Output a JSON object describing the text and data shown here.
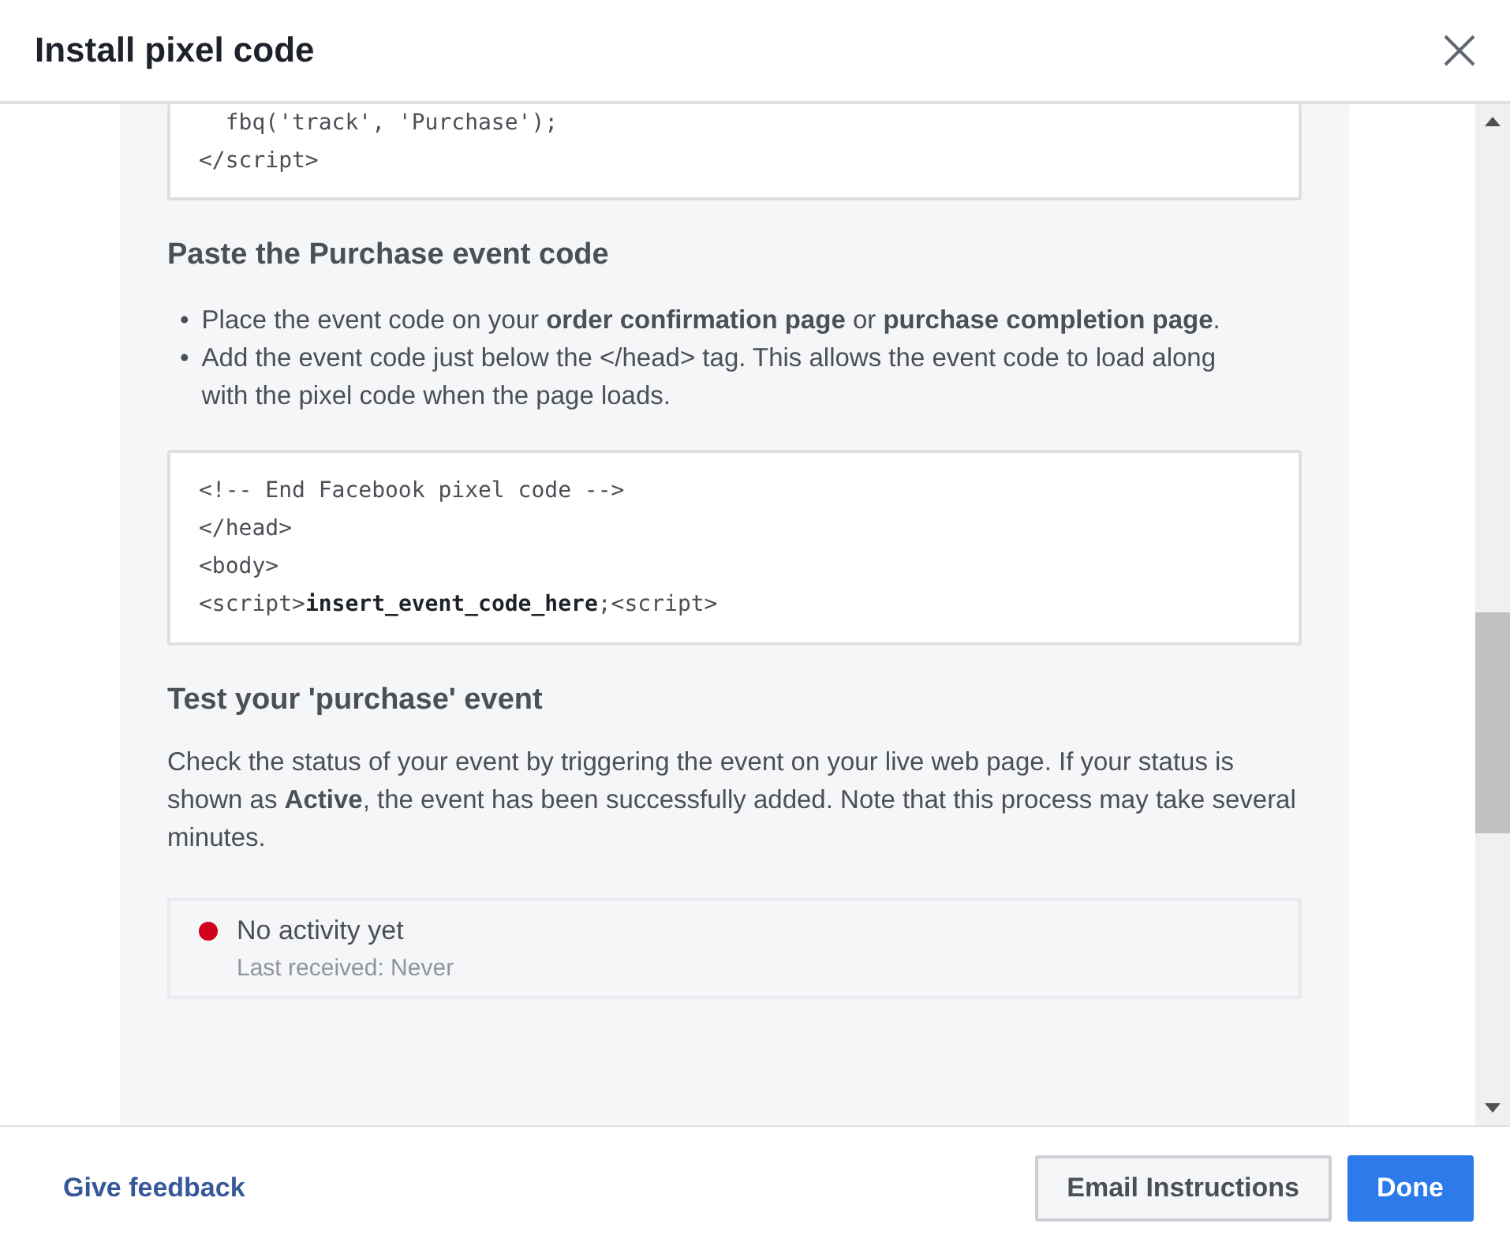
{
  "dialog": {
    "title": "Install pixel code"
  },
  "top_code": {
    "lines": [
      "  fbq('track', 'Purchase');",
      "</script>"
    ]
  },
  "sections": [
    {
      "heading": "Paste the Purchase event code",
      "bullets": [
        {
          "marker": "•",
          "text": "Place the event code on your **order confirmation page** or **purchase completion page**."
        },
        {
          "marker": "•",
          "text": "Add the event code just below the </head> tag. This allows the event code to load along with the pixel code when the page loads."
        }
      ],
      "code_lines": [
        "<!-- End Facebook pixel code -->",
        "</head>",
        "<body>",
        "<script>**insert_event_code_here**;<script>"
      ]
    },
    {
      "heading": "Test your 'purchase' event",
      "paragraph": "Check the status of your event by triggering the event on your live web page. If your status is shown as **Active**, the event has been successfully added. Note that this process may take several minutes.",
      "status": {
        "title": "No activity yet",
        "subtitle": "Last received: Never",
        "color": "#d0021b"
      }
    }
  ],
  "footer": {
    "link": "Give feedback",
    "buttons": [
      {
        "label": "Email Instructions",
        "kind": "secondary"
      },
      {
        "label": "Done",
        "kind": "primary"
      }
    ]
  }
}
